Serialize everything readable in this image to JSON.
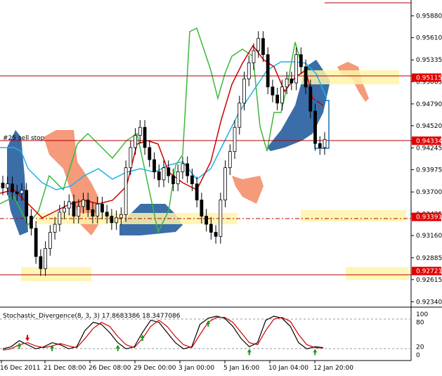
{
  "chart_data": {
    "type": "candlestick",
    "indicator_label": "Stochastic_Divergence(8, 3, 3) 17.8683386 18.3477086",
    "object_label": "#25 sell stop",
    "price_ticks": [
      "0.95880",
      "0.95610",
      "0.95335",
      "0.95065",
      "0.94790",
      "0.94520",
      "0.94245",
      "0.93975",
      "0.93700",
      "0.93425",
      "0.93160",
      "0.92885",
      "0.92615",
      "0.92340"
    ],
    "price_range": [
      0.923,
      0.9592
    ],
    "level_tags": [
      {
        "label": "0.95115",
        "value": 0.95115
      },
      {
        "label": "0.94334",
        "value": 0.94334
      },
      {
        "label": "0.93391",
        "value": 0.93391
      },
      {
        "label": "0.92721",
        "value": 0.92721
      }
    ],
    "stoch_ticks": [
      "100",
      "80",
      "20",
      "0"
    ],
    "stoch_range": [
      0,
      100
    ],
    "time_labels": [
      "16 Dec 2011",
      "21 Dec 08:00",
      "26 Dec 08:00",
      "29 Dec 00:00",
      "3 Jan 00:00",
      "5 Jan 16:00",
      "10 Jan 04:00",
      "12 Jan 20:00"
    ],
    "bars": [
      0.9375,
      0.938,
      0.937,
      0.9368,
      0.9372,
      0.934,
      0.9325,
      0.929,
      0.9275,
      0.93,
      0.932,
      0.933,
      0.9345,
      0.935,
      0.9358,
      0.934,
      0.9352,
      0.936,
      0.9348,
      0.934,
      0.9355,
      0.9345,
      0.934,
      0.9332,
      0.9338,
      0.9342,
      0.94,
      0.9425,
      0.944,
      0.945,
      0.9425,
      0.941,
      0.9395,
      0.9385,
      0.94,
      0.939,
      0.938,
      0.9395,
      0.9405,
      0.939,
      0.938,
      0.936,
      0.934,
      0.933,
      0.932,
      0.9315,
      0.936,
      0.94,
      0.942,
      0.945,
      0.948,
      0.951,
      0.953,
      0.9545,
      0.956,
      0.954,
      0.95,
      0.949,
      0.948,
      0.95,
      0.951,
      0.9505,
      0.954,
      0.9525,
      0.95,
      0.947,
      0.943,
      0.9425,
      0.9435
    ],
    "stoch_main": [
      15,
      20,
      35,
      25,
      15,
      20,
      30,
      25,
      15,
      20,
      60,
      80,
      75,
      55,
      30,
      15,
      20,
      55,
      85,
      80,
      55,
      30,
      15,
      20,
      75,
      90,
      95,
      90,
      70,
      40,
      20,
      30,
      85,
      95,
      90,
      70,
      30,
      15,
      20,
      18
    ],
    "stoch_signal": [
      12,
      15,
      25,
      30,
      22,
      18,
      22,
      28,
      22,
      18,
      40,
      65,
      80,
      70,
      45,
      25,
      18,
      40,
      70,
      85,
      70,
      45,
      25,
      18,
      50,
      80,
      92,
      92,
      80,
      55,
      30,
      25,
      60,
      88,
      92,
      82,
      50,
      25,
      18,
      17
    ],
    "arrows_up": [
      2,
      6,
      14,
      17,
      25,
      30,
      38
    ],
    "arrows_down": [
      3,
      40
    ]
  }
}
